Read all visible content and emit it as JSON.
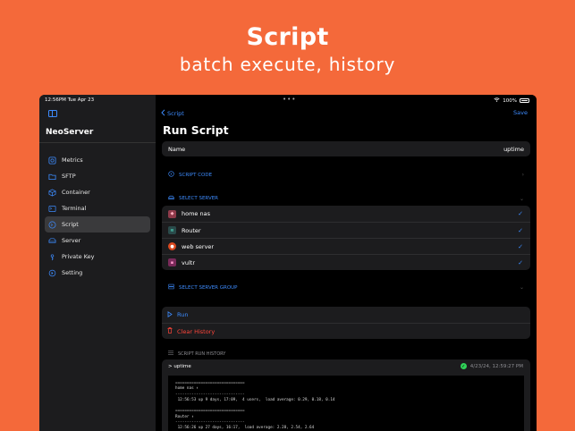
{
  "hero": {
    "title": "Script",
    "subtitle": "batch execute, history"
  },
  "status_bar": {
    "time": "12:56PM  Tue Apr 23",
    "battery": "100%"
  },
  "sidebar": {
    "app_name": "NeoServer",
    "items": [
      {
        "label": "Metrics",
        "icon": "metrics-icon"
      },
      {
        "label": "SFTP",
        "icon": "folder-icon"
      },
      {
        "label": "Container",
        "icon": "cube-icon"
      },
      {
        "label": "Terminal",
        "icon": "terminal-icon"
      },
      {
        "label": "Script",
        "icon": "script-icon",
        "active": true
      },
      {
        "label": "Server",
        "icon": "server-icon"
      },
      {
        "label": "Private Key",
        "icon": "key-icon"
      },
      {
        "label": "Setting",
        "icon": "gear-icon"
      }
    ]
  },
  "nav": {
    "back_label": "Script",
    "save_label": "Save",
    "title": "Run Script"
  },
  "form": {
    "name_label": "Name",
    "name_value": "uptime"
  },
  "sections": {
    "script_code": "SCRIPT CODE",
    "select_server": "SELECT SERVER",
    "select_server_group": "SELECT SERVER GROUP",
    "script_run_history": "SCRIPT RUN HISTORY"
  },
  "servers": [
    {
      "name": "home nas",
      "selected": true,
      "icon_color": "#8e3a4a"
    },
    {
      "name": "Router",
      "selected": true,
      "icon_color": "#2a4a4a"
    },
    {
      "name": "web server",
      "selected": true,
      "icon_color": "#d9481f"
    },
    {
      "name": "vultr",
      "selected": true,
      "icon_color": "#7a2a5a"
    }
  ],
  "actions": {
    "run_label": "Run",
    "clear_label": "Clear History"
  },
  "history": {
    "command": "> uptime",
    "timestamp": "4/23/24, 12:59:27 PM",
    "output": "==============================\nhome nas ↑\n------------------------------\n 12:56:53 up 9 days, 17:09,  4 users,  load average: 0.29, 0.18, 0.14\n\n==============================\nRouter ↑\n------------------------------\n 12:56:26 up 27 days, 16:17,  load average: 2.28, 2.54, 2.64"
  },
  "colors": {
    "accent": "#3d8bfd",
    "danger": "#ff453a",
    "background": "#f4693a"
  }
}
